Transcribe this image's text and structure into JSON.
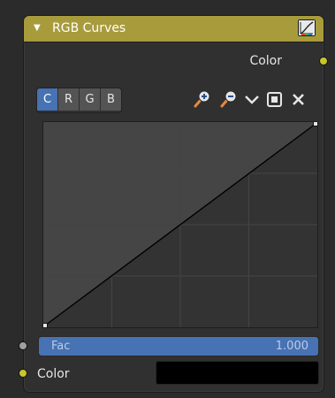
{
  "node": {
    "title": "RGB Curves",
    "collapse_icon": "triangle-down-icon",
    "preview_icon": "node-preview-icon",
    "header_color": "#a89b3c"
  },
  "outputs": {
    "color_label": "Color",
    "socket_color": "#c7c729"
  },
  "channels": {
    "items": [
      "C",
      "R",
      "G",
      "B"
    ],
    "active": "C",
    "active_color": "#4772b3"
  },
  "tools": {
    "icons": [
      "zoom-in-icon",
      "zoom-out-icon",
      "chevron-down-icon",
      "clipping-icon",
      "close-icon"
    ]
  },
  "curve": {
    "points": [
      [
        0,
        0
      ],
      [
        1,
        1
      ]
    ],
    "grid": true
  },
  "inputs": {
    "fac_label": "Fac",
    "fac_value": "1.000",
    "color_label": "Color",
    "color_value": "#000000"
  }
}
